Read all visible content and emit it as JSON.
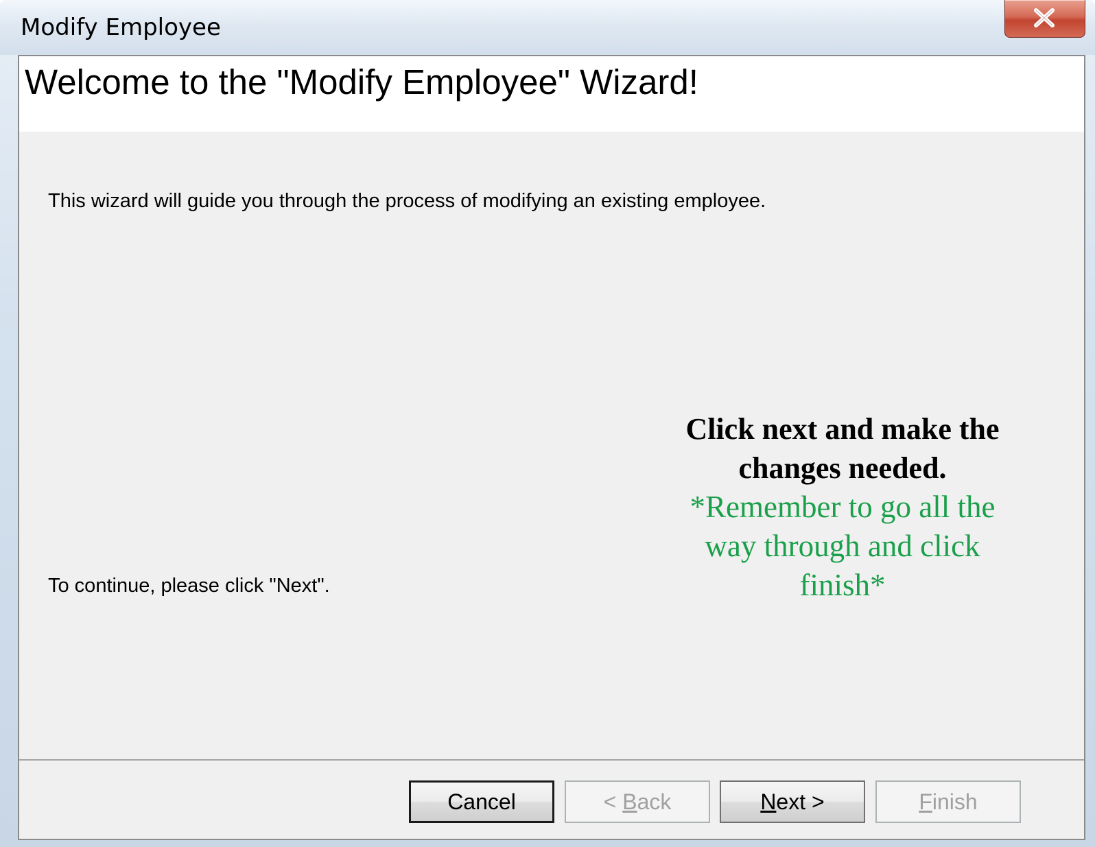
{
  "window": {
    "title": "Modify Employee",
    "close_icon": "close-icon"
  },
  "wizard": {
    "heading": "Welcome to the \"Modify Employee\" Wizard!",
    "intro": "This wizard will guide you through the process of modifying an existing employee.",
    "continue": "To continue, please click \"Next\"."
  },
  "annotation": {
    "bold_line1": "Click next and make the",
    "bold_line2": "changes needed.",
    "green_line1": "*Remember to go all the",
    "green_line2": "way through and click",
    "green_line3": "finish*",
    "green_color": "#1aa04a"
  },
  "buttons": {
    "cancel": {
      "label": "Cancel",
      "enabled": true
    },
    "back": {
      "prefix": "< ",
      "mnemonic": "B",
      "rest": "ack",
      "enabled": false
    },
    "next": {
      "mnemonic": "N",
      "rest": "ext >",
      "enabled": true
    },
    "finish": {
      "mnemonic": "F",
      "rest": "inish",
      "enabled": false
    }
  }
}
